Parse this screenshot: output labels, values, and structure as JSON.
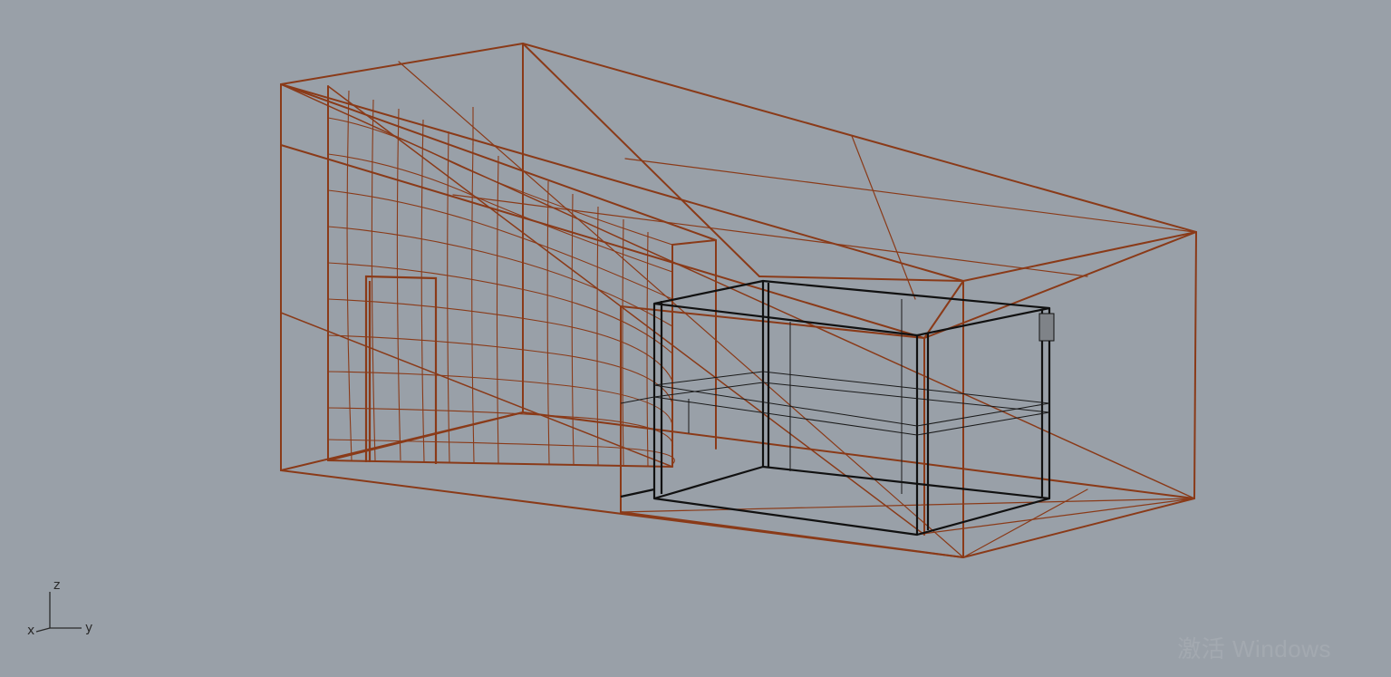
{
  "viewport": {
    "background_color": "#99a0a8",
    "projection": "perspective",
    "display_mode": "wireframe"
  },
  "objects": {
    "room_shell_color": "#8a3a18",
    "cabinet_color": "#111111",
    "door_color": "#8a3a18",
    "wall_mesh_color": "#8a3a18"
  },
  "axis_widget": {
    "x_label": "x",
    "y_label": "y",
    "z_label": "z"
  },
  "watermark": {
    "text": "激活 Windows"
  }
}
